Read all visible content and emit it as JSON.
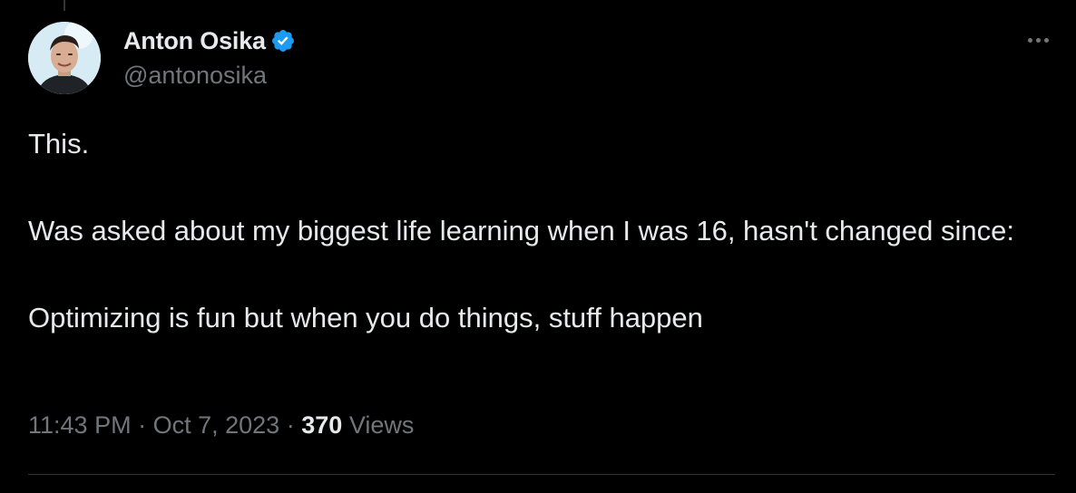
{
  "tweet": {
    "author": {
      "display_name": "Anton Osika",
      "handle": "@antonosika",
      "verified": true
    },
    "text": {
      "line1": "This.",
      "line2": "Was asked about my biggest life learning when I was 16, hasn't changed since:",
      "line3": "Optimizing is fun but when you do things, stuff happen"
    },
    "meta": {
      "time": "11:43 PM",
      "separator": "·",
      "date": "Oct 7, 2023",
      "views_count": "370",
      "views_label": "Views"
    }
  },
  "colors": {
    "background": "#000000",
    "primary_text": "#e7e9ea",
    "secondary_text": "#71767b",
    "verified_blue": "#1d9bf0",
    "divider": "#2f3336"
  },
  "icons": {
    "verified": "verified-badge-icon",
    "more": "more-horizontal-icon"
  }
}
